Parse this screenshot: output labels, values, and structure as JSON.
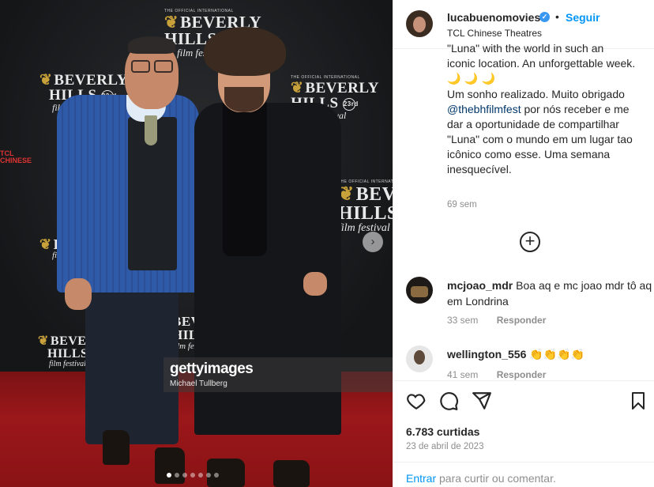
{
  "photo": {
    "logos": {
      "small": "THE OFFICIAL INTERNATIONAL",
      "line1": "BEVERLY",
      "line2": "HILLS",
      "fest": "film festival",
      "badge": "23rd"
    },
    "side_logo": "TCL CHINESE",
    "watermark": {
      "brand": "gettyimages",
      "credit": "Michael Tullberg"
    },
    "carousel_total": 7,
    "carousel_active": 1,
    "next_icon": "chevron-right-icon"
  },
  "post": {
    "username": "lucabuenomovies",
    "follow_label": "Seguir",
    "location": "TCL Chinese Theatres",
    "caption_clipped_line": "\"Luna\" with the world in such an",
    "caption_en_end": "iconic location. An unforgettable week.",
    "caption_emojis": "🌙 🌙 🌙",
    "caption_pt_1": "Um sonho realizado. Muito obrigado",
    "caption_mention": "@thebhfilmfest",
    "caption_pt_2": " por nós receber e me dar a oportunidade de compartilhar \"Luna\" com o mundo em um lugar tao icônico como esse. Uma semana inesquecível.",
    "caption_time": "69 sem"
  },
  "comments": [
    {
      "user": "mcjoao_mdr",
      "text": "Boa aq e mc joao mdr tô aq em Londrina",
      "time": "33 sem",
      "reply": "Responder"
    },
    {
      "user": "wellington_556",
      "text": "👏👏👏👏",
      "time": "41 sem",
      "reply": "Responder"
    }
  ],
  "likes": "6.783 curtidas",
  "date": "23 de abril de 2023",
  "login_prompt": {
    "link": "Entrar",
    "rest": " para curtir ou comentar."
  },
  "colors": {
    "accent": "#0095f6",
    "carpet": "#9b171a",
    "jacket": "#2f5aa8"
  }
}
